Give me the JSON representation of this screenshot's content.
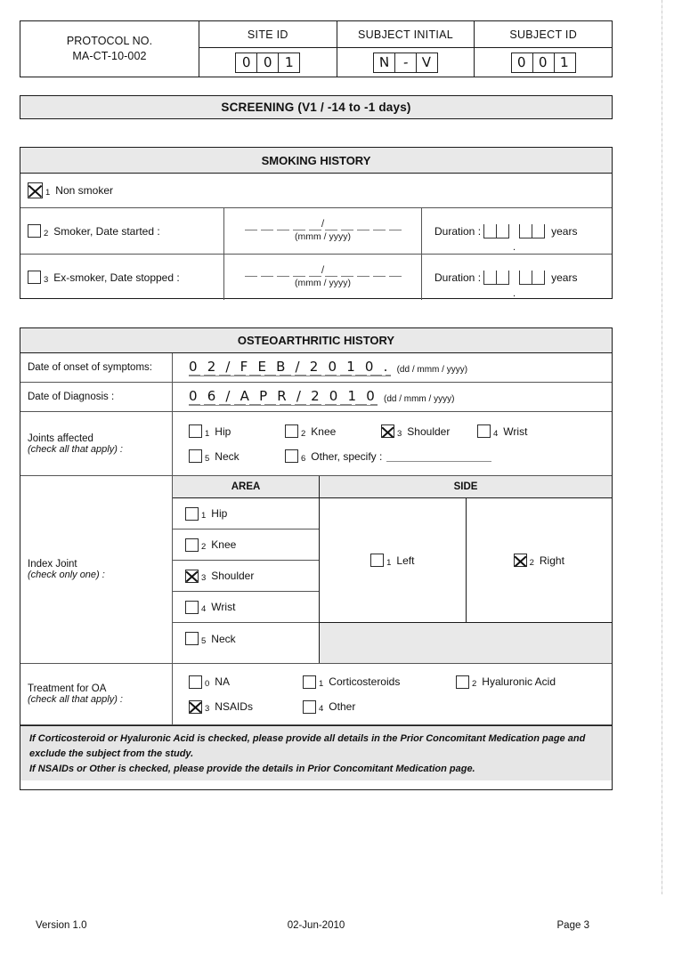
{
  "header": {
    "protocol_label": "PROTOCOL NO.",
    "protocol_value": "MA-CT-10-002",
    "site_id_label": "SITE ID",
    "site_id_value": [
      "0",
      "0",
      "1"
    ],
    "subject_initial_label": "SUBJECT INITIAL",
    "subject_initial_value": [
      "N",
      "-",
      "V"
    ],
    "subject_id_label": "SUBJECT ID",
    "subject_id_value": [
      "0",
      "0",
      "1"
    ]
  },
  "screening_banner": "SCREENING (V1 / -14 to -1 days)",
  "smoking": {
    "title": "SMOKING HISTORY",
    "rows": [
      {
        "num": "1",
        "label": "Non smoker",
        "checked": true
      },
      {
        "num": "2",
        "label": "Smoker, Date started :",
        "checked": false,
        "date_hint": "(mmm / yyyy)",
        "duration_label": "Duration :",
        "duration_unit": "years"
      },
      {
        "num": "3",
        "label": "Ex-smoker, Date stopped :",
        "checked": false,
        "date_hint": "(mmm / yyyy)",
        "duration_label": "Duration :",
        "duration_unit": "years"
      }
    ]
  },
  "oa": {
    "title": "OSTEOARTHRITIC HISTORY",
    "onset_label": "Date of onset of symptoms:",
    "onset_value": "0 2 / F E B / 2 0 1 0 .",
    "onset_format": "(dd / mmm / yyyy)",
    "diagnosis_label": "Date of Diagnosis :",
    "diagnosis_value": "0 6 / A P R / 2 0 1 0",
    "diagnosis_format": "(dd / mmm / yyyy)",
    "joints_label": "Joints affected",
    "joints_sublabel": "(check all that apply) :",
    "joints": [
      {
        "num": "1",
        "label": "Hip",
        "checked": false
      },
      {
        "num": "2",
        "label": "Knee",
        "checked": false
      },
      {
        "num": "3",
        "label": "Shoulder",
        "checked": true
      },
      {
        "num": "4",
        "label": "Wrist",
        "checked": false
      },
      {
        "num": "5",
        "label": "Neck",
        "checked": false
      },
      {
        "num": "6",
        "label": "Other, specify :",
        "checked": false
      }
    ],
    "index_label": "Index Joint",
    "index_sublabel": "(check only one) :",
    "area_header": "AREA",
    "side_header": "SIDE",
    "index_areas": [
      {
        "num": "1",
        "label": "Hip",
        "checked": false
      },
      {
        "num": "2",
        "label": "Knee",
        "checked": false
      },
      {
        "num": "3",
        "label": "Shoulder",
        "checked": true
      },
      {
        "num": "4",
        "label": "Wrist",
        "checked": false
      },
      {
        "num": "5",
        "label": "Neck",
        "checked": false
      }
    ],
    "index_sides": [
      {
        "num": "1",
        "label": "Left",
        "checked": false
      },
      {
        "num": "2",
        "label": "Right",
        "checked": true
      }
    ],
    "treatment_label": "Treatment for OA",
    "treatment_sublabel": "(check all that apply) :",
    "treatments": [
      {
        "num": "0",
        "label": "NA",
        "checked": false
      },
      {
        "num": "1",
        "label": "Corticosteroids",
        "checked": false
      },
      {
        "num": "2",
        "label": "Hyaluronic Acid",
        "checked": false
      },
      {
        "num": "3",
        "label": "NSAIDs",
        "checked": true
      },
      {
        "num": "4",
        "label": "Other",
        "checked": false
      }
    ],
    "note_line1": "If Corticosteroid or Hyaluronic Acid is checked, please provide all details in the Prior Concomitant Medication page and",
    "note_line2": "exclude the subject from the study.",
    "note_line3": "If NSAIDs or Other is checked, please provide the details in Prior Concomitant Medication page."
  },
  "footer": {
    "version": "Version 1.0",
    "date": "02-Jun-2010",
    "page": "Page 3"
  }
}
